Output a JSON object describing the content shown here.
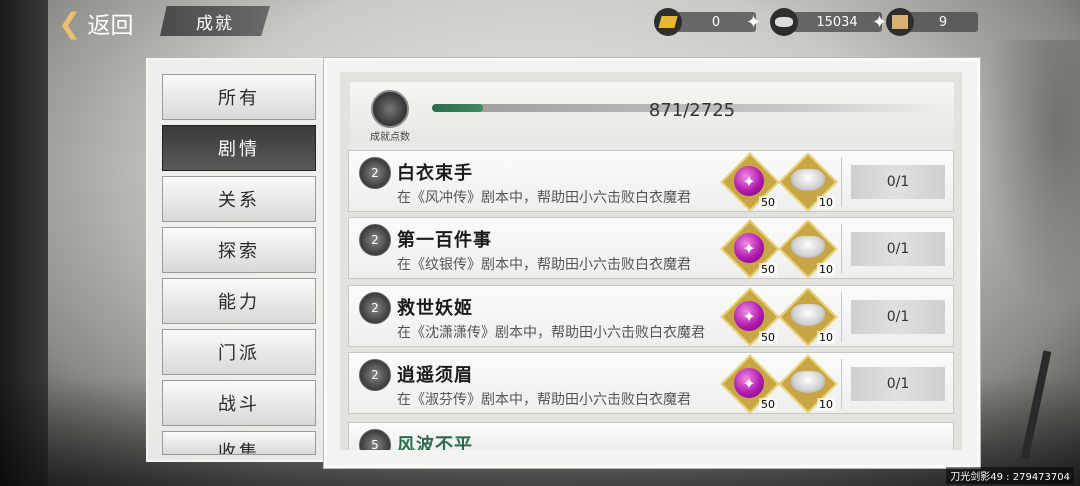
{
  "topbar": {
    "back_label": "返回",
    "title": "成就",
    "resources": [
      {
        "icon": "gold-ingot-icon",
        "value": "0",
        "has_plus": true
      },
      {
        "icon": "silver-ingot-icon",
        "value": "15034",
        "has_plus": true
      },
      {
        "icon": "scroll-icon",
        "value": "9",
        "has_plus": false
      }
    ]
  },
  "sidebar": {
    "items": [
      {
        "label": "所有",
        "active": false
      },
      {
        "label": "剧情",
        "active": true
      },
      {
        "label": "关系",
        "active": false
      },
      {
        "label": "探索",
        "active": false
      },
      {
        "label": "能力",
        "active": false
      },
      {
        "label": "门派",
        "active": false
      },
      {
        "label": "战斗",
        "active": false
      },
      {
        "label": "收集",
        "active": false
      }
    ]
  },
  "header": {
    "badge_label": "成就点数",
    "progress_text": "871/2725",
    "progress_fraction": 0.32
  },
  "achievements": [
    {
      "medal": "2",
      "name": "白衣束手",
      "desc": "在《风冲传》剧本中，帮助田小六击败白衣魔君",
      "rewards": [
        {
          "type": "orb",
          "qty": "50"
        },
        {
          "type": "silver",
          "qty": "10"
        }
      ],
      "progress": "0/1"
    },
    {
      "medal": "2",
      "name": "第一百件事",
      "desc": "在《纹银传》剧本中，帮助田小六击败白衣魔君",
      "rewards": [
        {
          "type": "orb",
          "qty": "50"
        },
        {
          "type": "silver",
          "qty": "10"
        }
      ],
      "progress": "0/1"
    },
    {
      "medal": "2",
      "name": "救世妖姬",
      "desc": "在《沈潇潇传》剧本中，帮助田小六击败白衣魔君",
      "rewards": [
        {
          "type": "orb",
          "qty": "50"
        },
        {
          "type": "silver",
          "qty": "10"
        }
      ],
      "progress": "0/1"
    },
    {
      "medal": "2",
      "name": "逍遥须眉",
      "desc": "在《淑芬传》剧本中，帮助田小六击败白衣魔君",
      "rewards": [
        {
          "type": "orb",
          "qty": "50"
        },
        {
          "type": "silver",
          "qty": "10"
        }
      ],
      "progress": "0/1"
    }
  ],
  "partial_row": {
    "medal": "5",
    "name": "风波不平"
  },
  "watermark": "刀光剑影49 : 279473704"
}
